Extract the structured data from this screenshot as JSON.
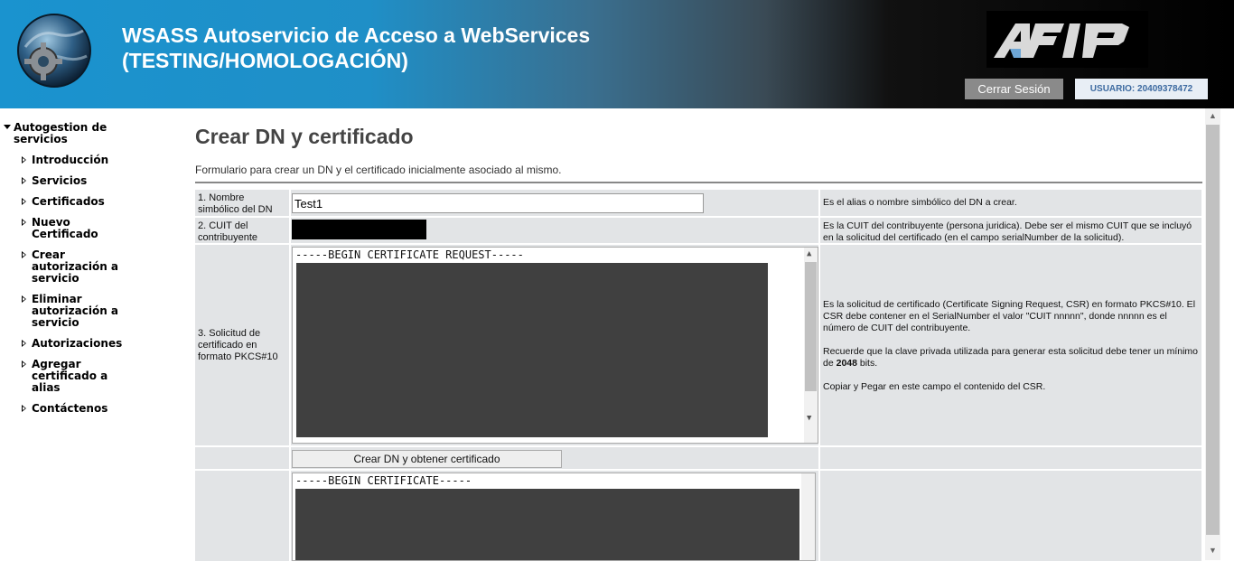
{
  "header": {
    "title_line1": "WSASS Autoservicio de Acceso a WebServices",
    "title_line2": "(TESTING/HOMOLOGACIÓN)",
    "logout_label": "Cerrar Sesión",
    "user_label": "USUARIO: 20409378472"
  },
  "sidebar": {
    "heading": "Autogestion de servicios",
    "items": [
      {
        "label": "Introducción"
      },
      {
        "label": "Servicios"
      },
      {
        "label": "Certificados"
      },
      {
        "label": "Nuevo Certificado"
      },
      {
        "label": "Crear autorización a servicio"
      },
      {
        "label": "Eliminar autorización a servicio"
      },
      {
        "label": "Autorizaciones"
      },
      {
        "label": "Agregar certificado a alias"
      },
      {
        "label": "Contáctenos"
      }
    ]
  },
  "main": {
    "title": "Crear DN y certificado",
    "description": "Formulario para crear un DN y el certificado inicialmente asociado al mismo.",
    "rows": [
      {
        "label": "1. Nombre simbólico del DN",
        "value": "Test1",
        "help": "Es el alias o nombre simbólico del DN a crear."
      },
      {
        "label": "2. CUIT del contribuyente",
        "help": "Es la CUIT del contribuyente (persona juridica). Debe ser el mismo CUIT que se incluyó en la solicitud del certificado (en el campo serialNumber de la solicitud)."
      },
      {
        "label": "3. Solicitud de certificado en formato PKCS#10",
        "csr_first_line": "-----BEGIN CERTIFICATE REQUEST-----",
        "help_p1": "Es la solicitud de certificado (Certificate Signing Request, CSR) en formato PKCS#10. El CSR debe contener en el SerialNumber el valor \"CUIT nnnnn\", donde nnnnn es el número de CUIT del contribuyente.",
        "help_p2_pre": "Recuerde que la clave privada utilizada para generar esta solicitud debe tener un mínimo de ",
        "help_p2_bold": "2048",
        "help_p2_post": " bits.",
        "help_p3": "Copiar y Pegar en este campo el contenido del CSR."
      }
    ],
    "submit_label": "Crear DN y obtener certificado",
    "cert_first_line": "-----BEGIN CERTIFICATE-----"
  },
  "colors": {
    "header_blue": "#1a93cf",
    "header_black": "#000000",
    "cell_bg": "#e2e4e6",
    "redaction": "#404040"
  }
}
